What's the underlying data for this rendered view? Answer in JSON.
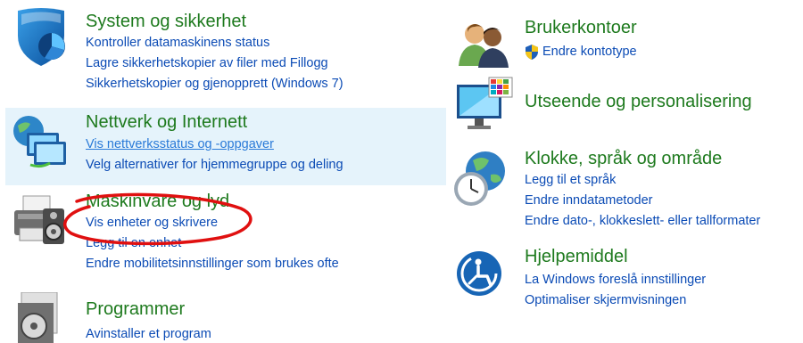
{
  "categories": {
    "system": {
      "title": "System og sikkerhet",
      "links": [
        "Kontroller datamaskinens status",
        "Lagre sikkerhetskopier av filer med Fillogg",
        "Sikkerhetskopier og gjenopprett (Windows 7)"
      ]
    },
    "network": {
      "title": "Nettverk og Internett",
      "links": [
        "Vis nettverksstatus og -oppgaver",
        "Velg alternativer for hjemmegruppe og deling"
      ]
    },
    "hardware": {
      "title": "Maskinvare og lyd",
      "links": [
        "Vis enheter og skrivere",
        "Legg til en enhet",
        "Endre mobilitetsinnstillinger som brukes ofte"
      ]
    },
    "programs": {
      "title": "Programmer",
      "links": [
        "Avinstaller et program"
      ]
    },
    "accounts": {
      "title": "Brukerkontoer",
      "links": [
        "Endre kontotype"
      ]
    },
    "appearance": {
      "title": "Utseende og personalisering",
      "links": []
    },
    "clock": {
      "title": "Klokke, språk og område",
      "links": [
        "Legg til et språk",
        "Endre inndatametoder",
        "Endre dato-, klokkeslett- eller tallformater"
      ]
    },
    "ease": {
      "title": "Hjelpemiddel",
      "links": [
        "La Windows foreslå innstillinger",
        "Optimaliser skjermvisningen"
      ]
    }
  },
  "colors": {
    "title_green": "#1e7a1e",
    "link_blue": "#0b4bb5",
    "hover_bg": "#e5f3fb",
    "annotation_red": "#e01010"
  }
}
